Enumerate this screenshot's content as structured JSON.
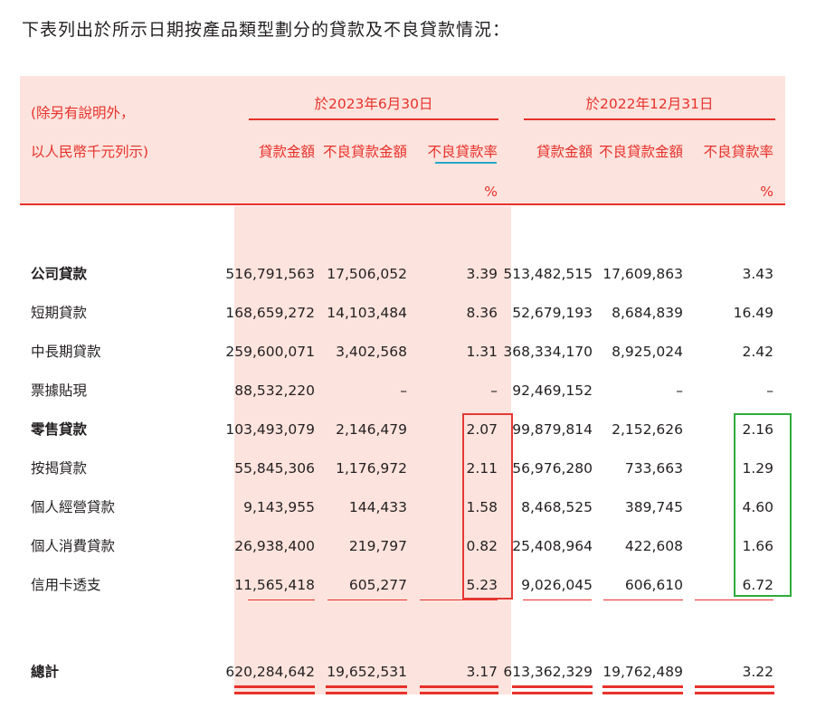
{
  "intro": "下表列出於所示日期按產品類型劃分的貸款及不良貸款情況：",
  "header": {
    "note_line1": "(除另有說明外，",
    "note_line2": "以人民幣千元列示)",
    "period1": "於2023年6月30日",
    "period2": "於2022年12月31日",
    "columns": [
      "貸款金額",
      "不良貸款金額",
      "不良貸款率",
      "貸款金額",
      "不良貸款金額",
      "不良貸款率"
    ],
    "pct1": "%",
    "pct2": "%"
  },
  "rows": [
    {
      "label": "公司貸款",
      "bold": true,
      "values": [
        "516,791,563",
        "17,506,052",
        "3.39",
        "513,482,515",
        "17,609,863",
        "3.43"
      ]
    },
    {
      "label": "短期貸款",
      "bold": false,
      "values": [
        "168,659,272",
        "14,103,484",
        "8.36",
        "52,679,193",
        "8,684,839",
        "16.49"
      ]
    },
    {
      "label": "中長期貸款",
      "bold": false,
      "values": [
        "259,600,071",
        "3,402,568",
        "1.31",
        "368,334,170",
        "8,925,024",
        "2.42"
      ]
    },
    {
      "label": "票據貼現",
      "bold": false,
      "values": [
        "88,532,220",
        "–",
        "–",
        "92,469,152",
        "–",
        "–"
      ]
    },
    {
      "label": "零售貸款",
      "bold": true,
      "values": [
        "103,493,079",
        "2,146,479",
        "2.07",
        "99,879,814",
        "2,152,626",
        "2.16"
      ]
    },
    {
      "label": "按揭貸款",
      "bold": false,
      "values": [
        "55,845,306",
        "1,176,972",
        "2.11",
        "56,976,280",
        "733,663",
        "1.29"
      ]
    },
    {
      "label": "個人經營貸款",
      "bold": false,
      "values": [
        "9,143,955",
        "144,433",
        "1.58",
        "8,468,525",
        "389,745",
        "4.60"
      ]
    },
    {
      "label": "個人消費貸款",
      "bold": false,
      "values": [
        "26,938,400",
        "219,797",
        "0.82",
        "25,408,964",
        "422,608",
        "1.66"
      ]
    },
    {
      "label": "信用卡透支",
      "bold": false,
      "values": [
        "11,565,418",
        "605,277",
        "5.23",
        "9,026,045",
        "606,610",
        "6.72"
      ]
    }
  ],
  "total": {
    "label": "總計",
    "values": [
      "620,284,642",
      "19,652,531",
      "3.17",
      "613,362,329",
      "19,762,489",
      "3.22"
    ]
  },
  "colors": {
    "accent_red": "#e8312b",
    "header_bg": "#fde3dd",
    "highlight_red_box": "#e53935",
    "highlight_green_box": "#2eab3a",
    "teal_underline": "#28a7c9"
  }
}
